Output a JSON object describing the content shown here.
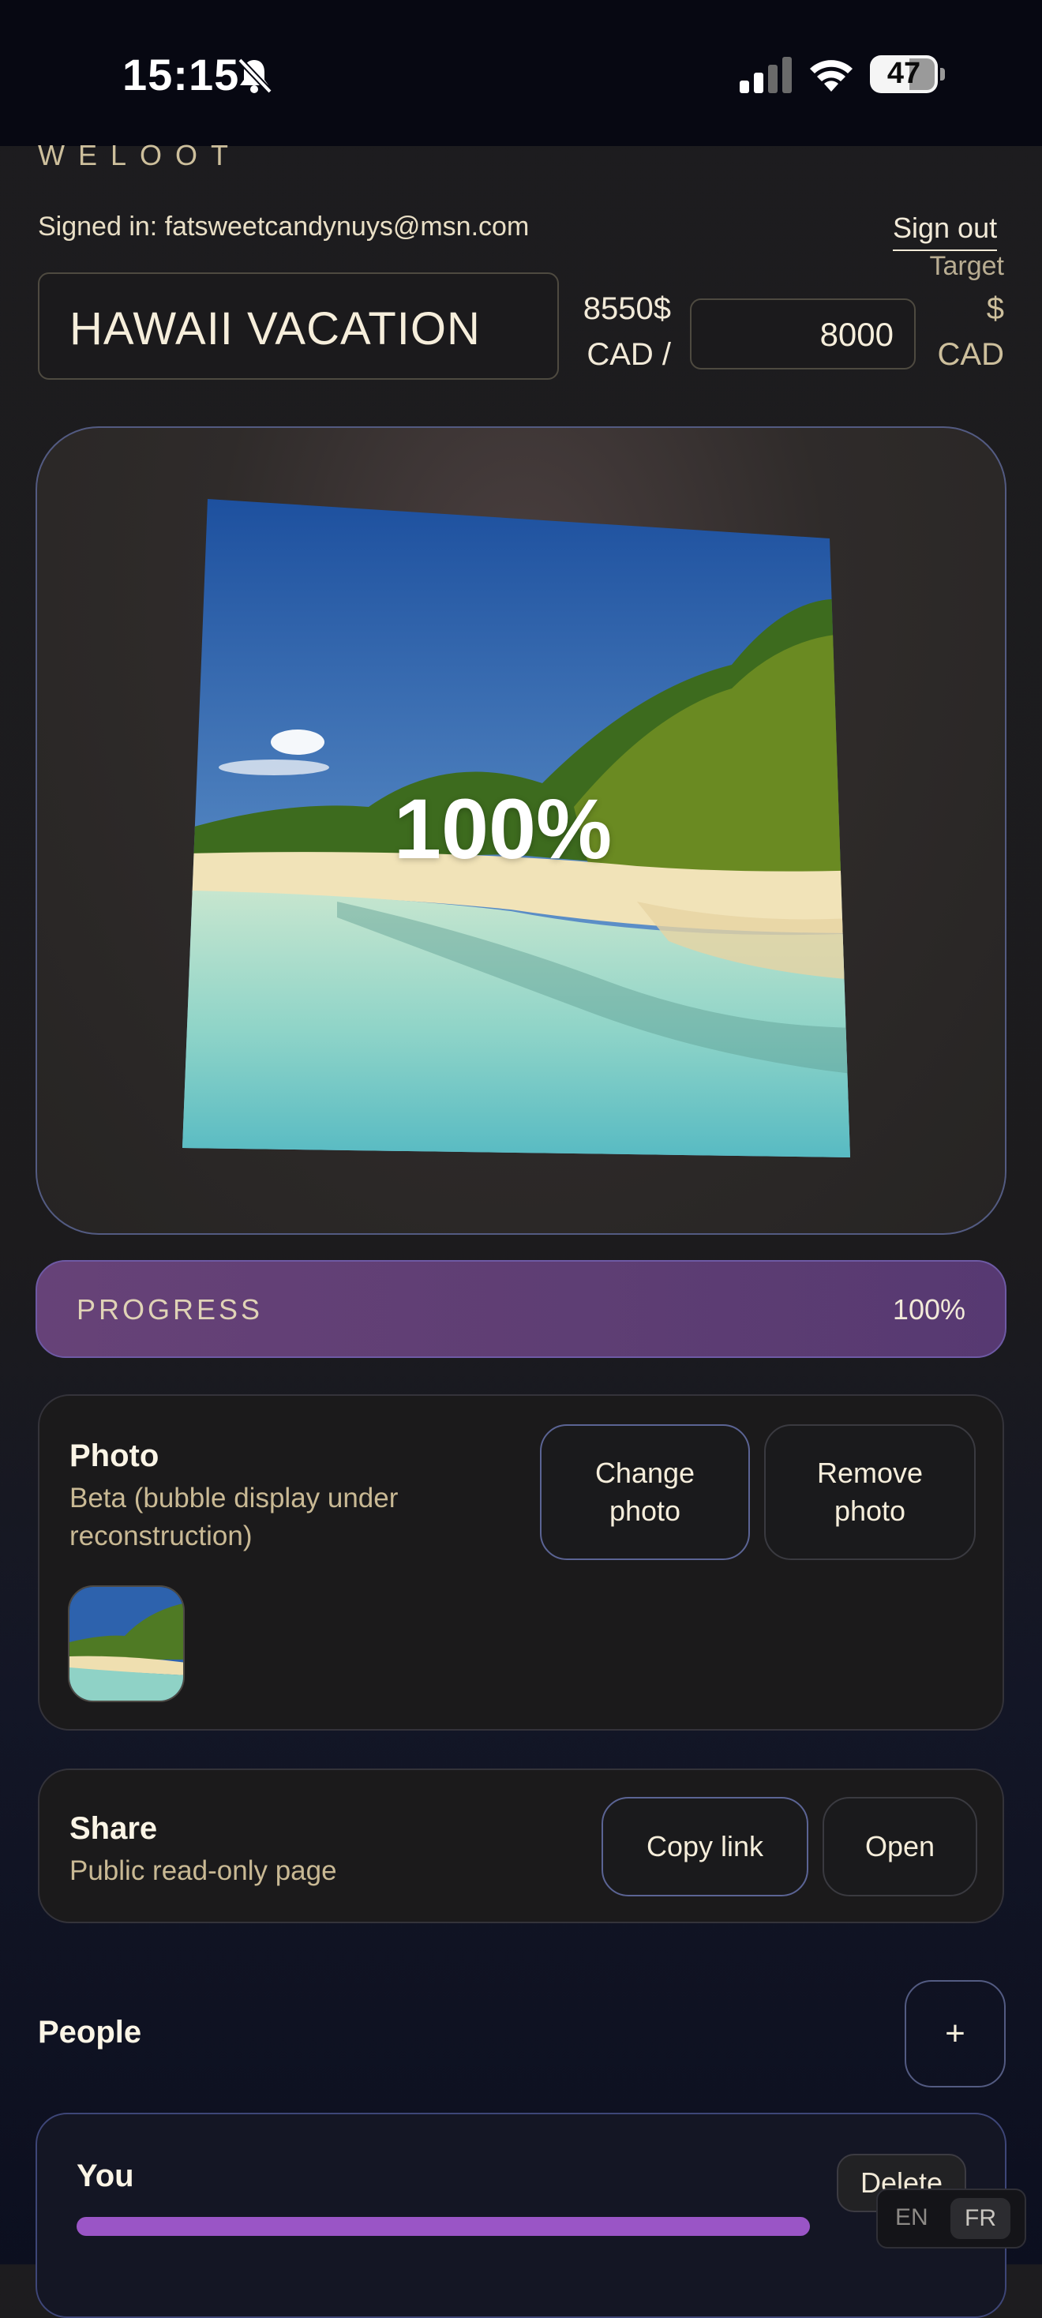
{
  "status_bar": {
    "time": "15:15",
    "battery": "47",
    "icons": [
      "bell-slash-icon",
      "signal-icon",
      "wifi-icon",
      "battery-icon"
    ]
  },
  "app": {
    "brand": "WELOOT"
  },
  "account": {
    "signed_in": "Signed in: fatsweetcandynuys@msn.com",
    "sign_out": "Sign out"
  },
  "goal": {
    "name": "HAWAII VACATION",
    "amount_line1": "8550$",
    "amount_line2": "CAD /",
    "target_label": "Target",
    "target_value": "8000",
    "target_currency_line1": "$",
    "target_currency_line2": "CAD",
    "photo_percent": "100%"
  },
  "progress": {
    "label": "PROGRESS",
    "value": "100%",
    "fraction": 1.0
  },
  "photo_panel": {
    "title": "Photo",
    "subtitle": "Beta (bubble display under reconstruction)",
    "change_line1": "Change",
    "change_line2": "photo",
    "remove_line1": "Remove",
    "remove_line2": "photo"
  },
  "share_panel": {
    "title": "Share",
    "subtitle": "Public read-only page",
    "copy_link": "Copy link",
    "open": "Open"
  },
  "people": {
    "title": "People",
    "add": "+",
    "members": [
      {
        "name": "You",
        "progress": 0.72
      }
    ],
    "delete": "Delete"
  },
  "language": {
    "en": "EN",
    "fr": "FR"
  },
  "colors": {
    "accent_purple": "#9a55c6",
    "progress_bg": "#55386a",
    "border_blue": "#535b82",
    "text_cream": "#f2ead8"
  }
}
